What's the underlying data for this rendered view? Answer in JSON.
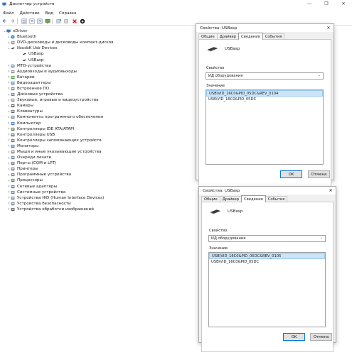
{
  "window": {
    "title": "Диспетчер устройств",
    "controls": [
      "—",
      "❐",
      "✕"
    ]
  },
  "menu": [
    "Файл",
    "Действие",
    "Вид",
    "Справка"
  ],
  "tree": {
    "root": "xDriver",
    "items": [
      {
        "label": "Bluetooth",
        "level": 1,
        "expanded": false,
        "icon": "bluetooth-icon"
      },
      {
        "label": "DVD-дисководы и дисководы компакт-дисков",
        "level": 1,
        "expanded": false,
        "icon": "dvd-icon"
      },
      {
        "label": "libusbK Usb Devices",
        "level": 1,
        "expanded": true,
        "icon": "usb-device-icon"
      },
      {
        "label": "USBasp",
        "level": 2,
        "expanded": null,
        "icon": "usb-device-icon"
      },
      {
        "label": "USBasp",
        "level": 2,
        "expanded": null,
        "icon": "usb-device-icon"
      },
      {
        "label": "MTD-устройства",
        "level": 1,
        "expanded": false,
        "icon": "mtd-icon"
      },
      {
        "label": "Аудиовходы и аудиовыходы",
        "level": 1,
        "expanded": false,
        "icon": "audio-icon"
      },
      {
        "label": "Батареи",
        "level": 1,
        "expanded": false,
        "icon": "battery-icon"
      },
      {
        "label": "Видеоадаптеры",
        "level": 1,
        "expanded": false,
        "icon": "display-adapter-icon"
      },
      {
        "label": "Встроенное ПО",
        "level": 1,
        "expanded": false,
        "icon": "firmware-icon"
      },
      {
        "label": "Дисковые устройства",
        "level": 1,
        "expanded": false,
        "icon": "disk-icon"
      },
      {
        "label": "Звуковые, игровые и видеоустройства",
        "level": 1,
        "expanded": false,
        "icon": "sound-icon"
      },
      {
        "label": "Камеры",
        "level": 1,
        "expanded": false,
        "icon": "camera-icon"
      },
      {
        "label": "Клавиатуры",
        "level": 1,
        "expanded": false,
        "icon": "keyboard-icon"
      },
      {
        "label": "Компоненты программного обеспечения",
        "level": 1,
        "expanded": false,
        "icon": "software-component-icon"
      },
      {
        "label": "Компьютер",
        "level": 1,
        "expanded": false,
        "icon": "computer-icon"
      },
      {
        "label": "Контроллеры IDE ATA/ATAPI",
        "level": 1,
        "expanded": false,
        "icon": "ide-controller-icon"
      },
      {
        "label": "Контроллеры USB",
        "level": 1,
        "expanded": false,
        "icon": "usb-controller-icon"
      },
      {
        "label": "Контроллеры запоминающих устройств",
        "level": 1,
        "expanded": false,
        "icon": "storage-controller-icon"
      },
      {
        "label": "Мониторы",
        "level": 1,
        "expanded": false,
        "icon": "monitor-icon"
      },
      {
        "label": "Мыши и иные указывающие устройства",
        "level": 1,
        "expanded": false,
        "icon": "mouse-icon"
      },
      {
        "label": "Очереди печати",
        "level": 1,
        "expanded": false,
        "icon": "print-queue-icon"
      },
      {
        "label": "Порты (COM и LPT)",
        "level": 1,
        "expanded": false,
        "icon": "port-icon"
      },
      {
        "label": "Принтеры",
        "level": 1,
        "expanded": false,
        "icon": "printer-icon"
      },
      {
        "label": "Программные устройства",
        "level": 1,
        "expanded": false,
        "icon": "software-device-icon"
      },
      {
        "label": "Процессоры",
        "level": 1,
        "expanded": false,
        "icon": "processor-icon"
      },
      {
        "label": "Сетевые адаптеры",
        "level": 1,
        "expanded": false,
        "icon": "network-adapter-icon"
      },
      {
        "label": "Системные устройства",
        "level": 1,
        "expanded": false,
        "icon": "system-device-icon"
      },
      {
        "label": "Устройства HID (Human Interface Devices)",
        "level": 1,
        "expanded": false,
        "icon": "hid-icon"
      },
      {
        "label": "Устройства безопасности",
        "level": 1,
        "expanded": false,
        "icon": "security-device-icon"
      },
      {
        "label": "Устройства обработки изображений",
        "level": 1,
        "expanded": false,
        "icon": "imaging-device-icon"
      }
    ]
  },
  "dialogs": [
    {
      "title": "Свойства: USBasp",
      "tabs": [
        "Общие",
        "Драйвер",
        "Сведения",
        "События"
      ],
      "active_tab": 2,
      "device_name": "USBasp",
      "property_label": "Свойство",
      "property_value": "ИД оборудования",
      "value_label": "Значение",
      "values": [
        "USB\\VID_16C0&PID_05DC&REV_0104",
        "USB\\VID_16C0&PID_05DC"
      ],
      "selected_value": 0,
      "ok": "OK",
      "cancel": "Отмена"
    },
    {
      "title": "Свойства: USBasp",
      "tabs": [
        "Общие",
        "Драйвер",
        "Сведения",
        "События"
      ],
      "active_tab": 2,
      "device_name": "USBasp",
      "property_label": "Свойство",
      "property_value": "ИД оборудования",
      "value_label": "Значение",
      "values": [
        "USB\\VID_16C0&PID_05DC&REV_0105",
        "USB\\VID_16C0&PID_05DC"
      ],
      "selected_value": 0,
      "ok": "OK",
      "cancel": "Отмена"
    }
  ]
}
